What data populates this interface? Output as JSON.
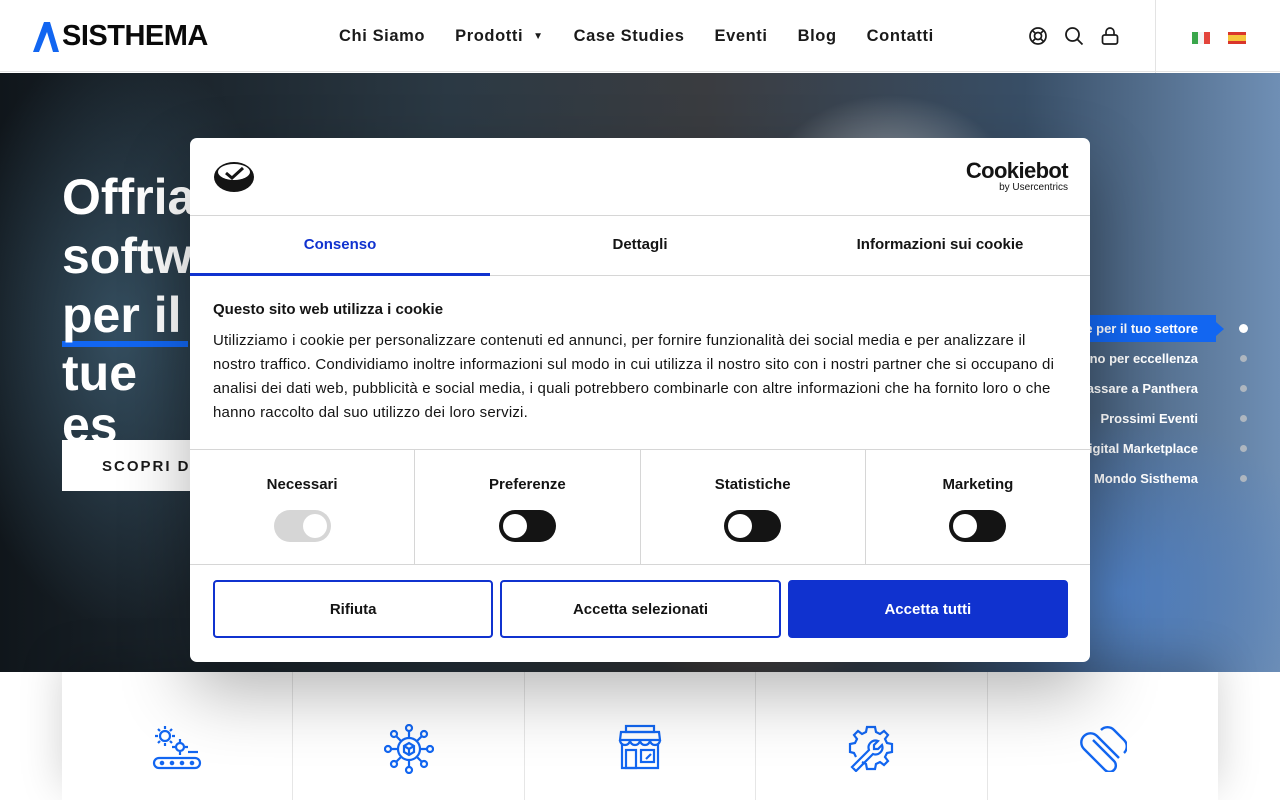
{
  "header": {
    "logo_text": "SISTHEMA",
    "nav": [
      {
        "label": "Chi Siamo",
        "has_dropdown": false
      },
      {
        "label": "Prodotti",
        "has_dropdown": true
      },
      {
        "label": "Case Studies",
        "has_dropdown": false
      },
      {
        "label": "Eventi",
        "has_dropdown": false
      },
      {
        "label": "Blog",
        "has_dropdown": false
      },
      {
        "label": "Contatti",
        "has_dropdown": false
      }
    ],
    "icons": [
      "lifebuoy-icon",
      "search-icon",
      "lock-icon"
    ],
    "languages": [
      "it",
      "es"
    ],
    "accent_color": "#1266f1"
  },
  "hero": {
    "title_lines": [
      "Offria",
      "softw",
      "per il",
      "tue es"
    ],
    "cta_label": "SCOPRI DI",
    "side_nav": [
      {
        "label": "e per il tuo settore",
        "active": true
      },
      {
        "label": "ino per eccellenza",
        "active": false
      },
      {
        "label": "assare a Panthera",
        "active": false
      },
      {
        "label": "Prossimi Eventi",
        "active": false
      },
      {
        "label": "igital Marketplace",
        "active": false
      },
      {
        "label": "Mondo Sisthema",
        "active": false
      }
    ]
  },
  "features": {
    "icons": [
      "conveyor-gears-icon",
      "network-cube-icon",
      "store-icon",
      "gear-wrench-icon",
      "paperclip-icon"
    ]
  },
  "cookie_dialog": {
    "brand_name": "Cookiebot",
    "brand_sub": "by Usercentrics",
    "tabs": [
      {
        "label": "Consenso",
        "active": true
      },
      {
        "label": "Dettagli",
        "active": false
      },
      {
        "label": "Informazioni sui cookie",
        "active": false
      }
    ],
    "heading": "Questo sito web utilizza i cookie",
    "text": "Utilizziamo i cookie per personalizzare contenuti ed annunci, per fornire funzionalità dei social media e per analizzare il nostro traffico. Condividiamo inoltre informazioni sul modo in cui utilizza il nostro sito con i nostri partner che si occupano di analisi dei dati web, pubblicità e social media, i quali potrebbero combinarle con altre informazioni che ha fornito loro o che hanno raccolto dal suo utilizzo dei loro servizi.",
    "categories": [
      {
        "name": "Necessari",
        "checked": true,
        "disabled": true
      },
      {
        "name": "Preferenze",
        "checked": false,
        "disabled": false
      },
      {
        "name": "Statistiche",
        "checked": false,
        "disabled": false
      },
      {
        "name": "Marketing",
        "checked": false,
        "disabled": false
      }
    ],
    "buttons": {
      "reject": "Rifiuta",
      "accept_selected": "Accetta selezionati",
      "accept_all": "Accetta tutti"
    },
    "primary_color": "#1032cf"
  }
}
